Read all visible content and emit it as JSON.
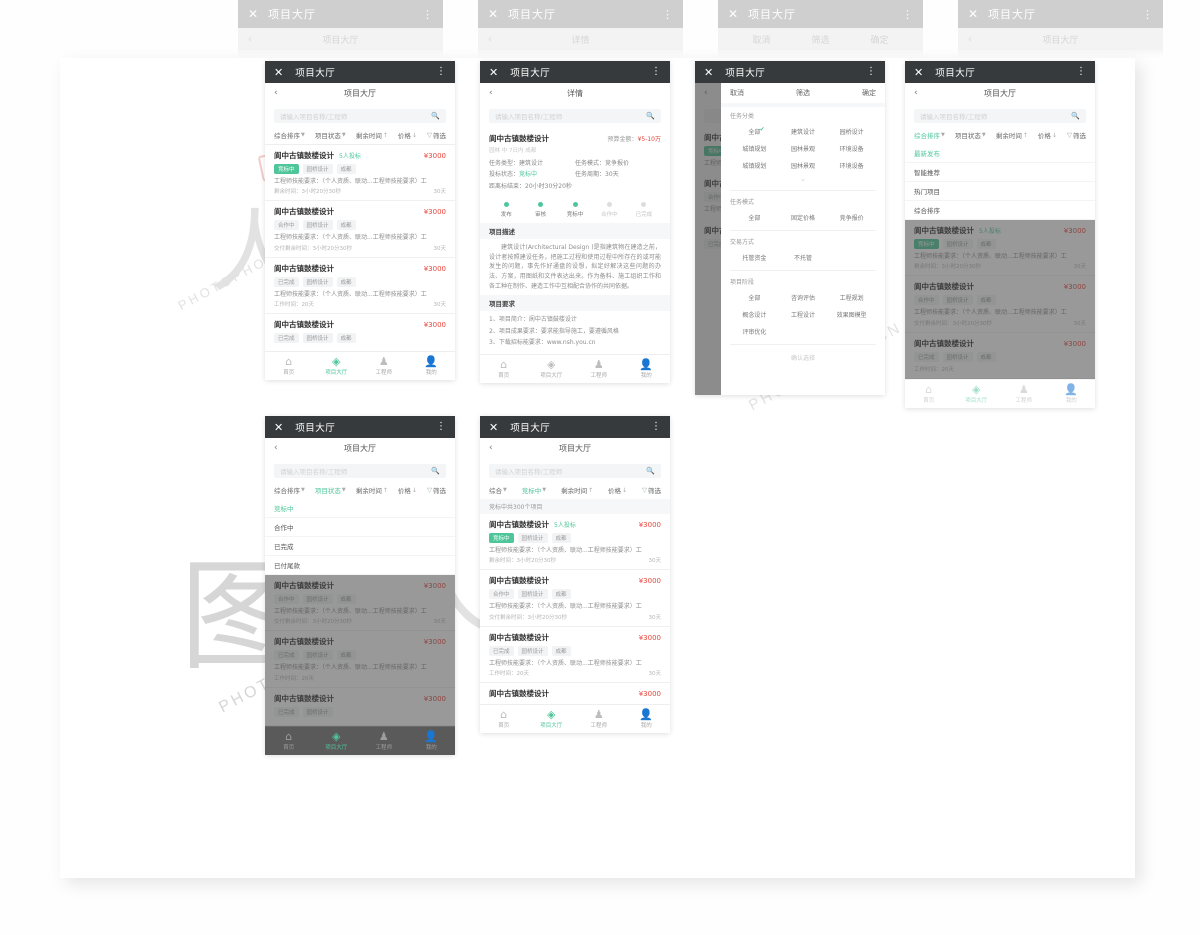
{
  "ghost_tabs": [
    {
      "title": "项目大厅",
      "sub": "项目大厅"
    },
    {
      "title": "项目大厅",
      "sub": "详情"
    },
    {
      "title": "项目大厅",
      "sub": "筛选"
    },
    {
      "title": "项目大厅",
      "sub": "项目大厅"
    }
  ],
  "ghost_filter_cols": [
    "取消",
    "筛选",
    "确定"
  ],
  "icons": {
    "close": "close-icon",
    "more": "more-vertical-icon",
    "back": "chevron-left-icon",
    "search": "search-icon",
    "caret": "chevron-down-icon",
    "sort_up": "arrow-up-icon",
    "sort_down": "arrow-down-icon",
    "funnel": "funnel-icon",
    "check": "check-icon",
    "chevron_more": "chevron-down-icon",
    "home": "home-icon",
    "hall": "layers-icon",
    "engineer": "engineer-icon",
    "mine": "user-icon"
  },
  "colors": {
    "titlebar": "#373a3c",
    "accent": "#4ec69a",
    "price": "#e8443a",
    "page_bg": "#fefefe",
    "card_bg": "#ffffff",
    "muted": "#9a9a9a"
  },
  "titlebar": {
    "title": "项目大厅"
  },
  "navbar": {
    "hall": "项目大厅",
    "detail": "详情"
  },
  "search": {
    "placeholder": "请输入项目名称/工程师"
  },
  "filterbar": {
    "sort": "综合排序",
    "sort_short": "综合",
    "status": "项目状态",
    "status_active": "竞标中",
    "time": "剩余时间",
    "price": "价格",
    "filter": "筛选"
  },
  "count_bar": "竞标中共300个项目",
  "projects": [
    {
      "title": "阆中古镇鼓楼设计",
      "bidders": "5人投标",
      "price": "¥3000",
      "tags": [
        "竞标中",
        "园桥设计",
        "成都"
      ],
      "tag_state": "green",
      "desc": "工程师技能要求：（个人资质、联动...工程师技能要求）工",
      "meta_left": "剩余时间：3小时20分30秒",
      "meta_right": "30天"
    },
    {
      "title": "阆中古镇鼓楼设计",
      "bidders": "",
      "price": "¥3000",
      "tags": [
        "合作中",
        "园桥设计",
        "成都"
      ],
      "tag_state": "grey",
      "desc": "工程师技能要求：（个人资质、联动...工程师技能要求）工",
      "meta_left": "交付剩余时间：3小时20分30秒",
      "meta_right": "30天"
    },
    {
      "title": "阆中古镇鼓楼设计",
      "bidders": "",
      "price": "¥3000",
      "tags": [
        "已完成",
        "园桥设计",
        "成都"
      ],
      "tag_state": "grey",
      "desc": "工程师技能要求：（个人资质、联动...工程师技能要求）工",
      "meta_left": "工作时间：20天",
      "meta_right": "30天"
    },
    {
      "title": "阆中古镇鼓楼设计",
      "bidders": "",
      "price": "¥3000",
      "tags": [
        "已完成",
        "园桥设计",
        "成都"
      ],
      "tag_state": "grey",
      "desc": "",
      "meta_left": "",
      "meta_right": ""
    }
  ],
  "tabbar": [
    {
      "label": "首页",
      "icon": "home-icon",
      "active": false
    },
    {
      "label": "项目大厅",
      "icon": "layers-icon",
      "active": true
    },
    {
      "label": "工程师",
      "icon": "engineer-icon",
      "active": false
    },
    {
      "label": "我的",
      "icon": "user-icon",
      "active": false
    }
  ],
  "detail": {
    "title": "阆中古镇鼓楼设计",
    "subtitle": "园林 中 7日内 成都",
    "amount_label": "预算金额：",
    "amount_value": "¥5-10万",
    "fields": [
      {
        "label": "任务类型：",
        "value": "建筑设计",
        "green": false
      },
      {
        "label": "任务模式：",
        "value": "竞争报价",
        "green": false
      },
      {
        "label": "投标状态：",
        "value": "竞标中",
        "green": true
      },
      {
        "label": "任务周期：",
        "value": "30天",
        "green": false
      },
      {
        "label": "距离标结束：",
        "value": "20小时30分20秒",
        "green": false
      }
    ],
    "steps": [
      {
        "label": "发布",
        "on": true
      },
      {
        "label": "审核",
        "on": true
      },
      {
        "label": "竞标中",
        "on": true
      },
      {
        "label": "合作中",
        "on": false
      },
      {
        "label": "已完成",
        "on": false
      }
    ],
    "desc_head": "项目描述",
    "desc_body": "建筑设计(Architectural Design )是指建筑物在建造之前，设计者按照建设任务，把施工过程和使用过程中所存在的或可能发生的问题，事先作好通盘的设想，拟定好解决这些问题的办法、方案，用图纸和文件表达出来。作为备料、施工组织工作和各工种在制作、建造工作中互相配合协作的共同依据。",
    "req_head": "项目要求",
    "req_items": [
      "1、项目简介：阆中古镇鼓楼设计",
      "2、项目成果要求：要求能指导施工，要遵循风格",
      "3、下载招标能要求：www.nsh.you.cn"
    ]
  },
  "filter_panel": {
    "cancel": "取消",
    "title": "筛选",
    "confirm": "确定",
    "groups": [
      {
        "label": "任务分类",
        "options": [
          "全部",
          "建筑设计",
          "园桥设计",
          "城镇规划",
          "园林景观",
          "环境设备",
          "城镇规划",
          "园林景观",
          "环境设备"
        ],
        "checked": 0,
        "more": true,
        "cols": 3
      },
      {
        "label": "任务模式",
        "options": [
          "全部",
          "固定价格",
          "竞争报价"
        ],
        "checked": -1,
        "more": false,
        "cols": 3
      },
      {
        "label": "交易方式",
        "options": [
          "托管资金",
          "不托管"
        ],
        "checked": -1,
        "more": false,
        "cols": 2
      },
      {
        "label": "项目阶段",
        "options": [
          "全部",
          "咨询评估",
          "工程规划",
          "概念设计",
          "工程设计",
          "效果图模型",
          "评审优化"
        ],
        "checked": -1,
        "more": false,
        "cols": 3
      }
    ],
    "footer": "确认选择"
  },
  "dropdown_sort": {
    "trigger": "综合排序",
    "items": [
      {
        "label": "最新发布",
        "active": true
      },
      {
        "label": "智能推荐",
        "active": false
      },
      {
        "label": "热门项目",
        "active": false
      },
      {
        "label": "综合排序",
        "active": false
      }
    ]
  },
  "dropdown_status": {
    "trigger": "项目状态",
    "items": [
      {
        "label": "竞标中",
        "active": true
      },
      {
        "label": "合作中",
        "active": false
      },
      {
        "label": "已完成",
        "active": false
      },
      {
        "label": "已付尾款",
        "active": false
      }
    ]
  },
  "watermark": {
    "text": "PHOTOPHOTO.CN",
    "mark": "图行天下"
  }
}
